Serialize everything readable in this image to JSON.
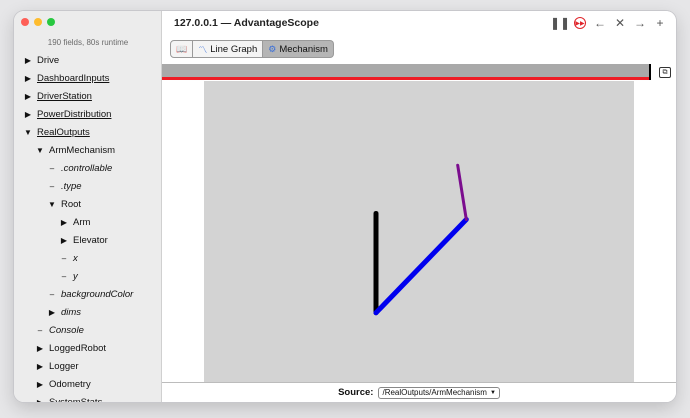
{
  "window": {
    "title": "127.0.0.1 — AdvantageScope"
  },
  "sidebar": {
    "info": "190 fields, 80s runtime",
    "items": [
      {
        "label": "Drive",
        "marker": "▶",
        "depth": 0,
        "style": "plain"
      },
      {
        "label": "DashboardInputs",
        "marker": "▶",
        "depth": 0,
        "style": "link"
      },
      {
        "label": "DriverStation",
        "marker": "▶",
        "depth": 0,
        "style": "link"
      },
      {
        "label": "PowerDistribution",
        "marker": "▶",
        "depth": 0,
        "style": "link"
      },
      {
        "label": "RealOutputs",
        "marker": "▼",
        "depth": 0,
        "style": "link"
      },
      {
        "label": "ArmMechanism",
        "marker": "▼",
        "depth": 1,
        "style": "plain"
      },
      {
        "label": ".controllable",
        "marker": "–",
        "depth": 2,
        "style": "italic"
      },
      {
        "label": ".type",
        "marker": "–",
        "depth": 2,
        "style": "italic"
      },
      {
        "label": "Root",
        "marker": "▼",
        "depth": 2,
        "style": "plain"
      },
      {
        "label": "Arm",
        "marker": "▶",
        "depth": 3,
        "style": "plain"
      },
      {
        "label": "Elevator",
        "marker": "▶",
        "depth": 3,
        "style": "plain"
      },
      {
        "label": "x",
        "marker": "–",
        "depth": 3,
        "style": "italic"
      },
      {
        "label": "y",
        "marker": "–",
        "depth": 3,
        "style": "italic"
      },
      {
        "label": "backgroundColor",
        "marker": "–",
        "depth": 2,
        "style": "italic"
      },
      {
        "label": "dims",
        "marker": "▶",
        "depth": 2,
        "style": "italic"
      },
      {
        "label": "Console",
        "marker": "–",
        "depth": 1,
        "style": "italic"
      },
      {
        "label": "LoggedRobot",
        "marker": "▶",
        "depth": 1,
        "style": "plain"
      },
      {
        "label": "Logger",
        "marker": "▶",
        "depth": 1,
        "style": "plain"
      },
      {
        "label": "Odometry",
        "marker": "▶",
        "depth": 1,
        "style": "plain"
      },
      {
        "label": "SystemStats",
        "marker": "▶",
        "depth": 1,
        "style": "plain"
      }
    ]
  },
  "tabs": [
    {
      "label": "",
      "icon": "📖",
      "name": "tab-docs",
      "active": false
    },
    {
      "label": "Line Graph",
      "icon": "〽",
      "name": "tab-line-graph",
      "active": false
    },
    {
      "label": "Mechanism",
      "icon": "⚙",
      "name": "tab-mechanism",
      "active": true
    }
  ],
  "timeline": {
    "progress": 1.0
  },
  "mechanism": {
    "background": "#d3d3d3",
    "segments": [
      {
        "color": "#000000",
        "from": [
          0.4,
          0.44
        ],
        "to": [
          0.4,
          0.77
        ]
      },
      {
        "color": "#0000ee",
        "from": [
          0.4,
          0.77
        ],
        "to": [
          0.61,
          0.46
        ]
      },
      {
        "color": "#7b0d8e",
        "from": [
          0.61,
          0.46
        ],
        "to": [
          0.59,
          0.28
        ]
      }
    ]
  },
  "footer": {
    "label": "Source:",
    "source_value": "/RealOutputs/ArmMechanism"
  },
  "colors": {
    "accent": "#3a6fd8",
    "record": "#e0252b",
    "progress": "#ee1c25"
  }
}
